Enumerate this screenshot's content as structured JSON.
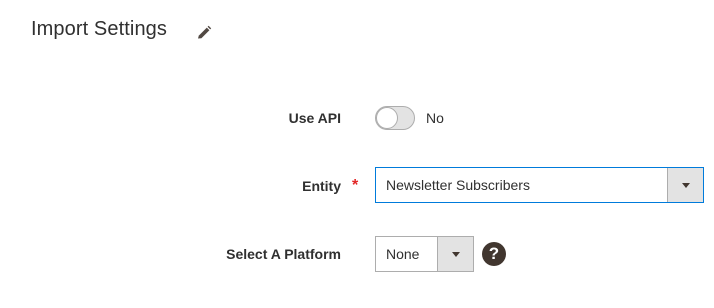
{
  "section": {
    "title": "Import Settings",
    "edit_icon": "pencil-icon"
  },
  "fields": {
    "use_api": {
      "label": "Use API",
      "value_text": "No",
      "checked": false
    },
    "entity": {
      "label": "Entity",
      "required_mark": "*",
      "selected": "Newsletter Subscribers"
    },
    "platform": {
      "label": "Select A Platform",
      "selected": "None",
      "help_icon": "?"
    }
  },
  "colors": {
    "text": "#303030",
    "required": "#e22626",
    "focus_border": "#007bdb",
    "border": "#adadad",
    "arrow_bg": "#e3e3e3",
    "help_bg": "#41362f"
  }
}
